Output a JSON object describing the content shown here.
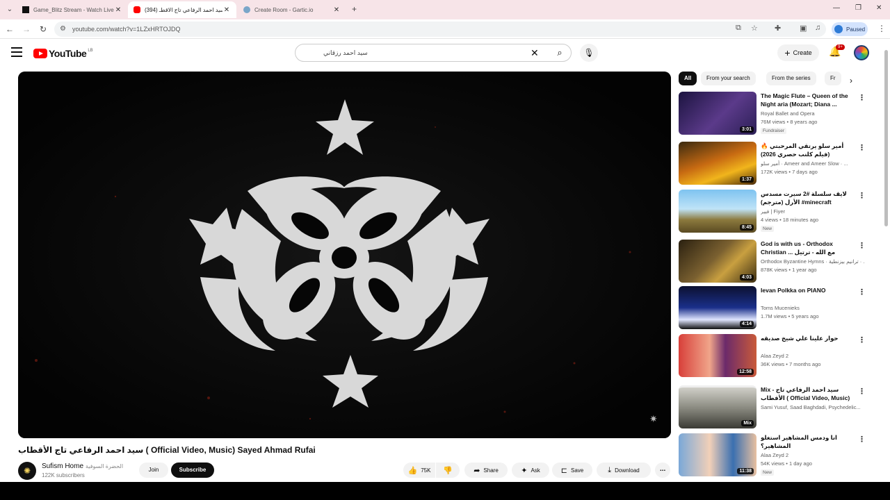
{
  "browser": {
    "tabs": [
      {
        "title": "Game_Blitz Stream - Watch Live",
        "active": false
      },
      {
        "title": "(394) سيد احمد الرفاعي تاج الاقطـ",
        "active": true
      },
      {
        "title": "Create Room - Gartic.io",
        "active": false
      }
    ],
    "url": "youtube.com/watch?v=1LZxHRTOJDQ",
    "profile_status": "Paused"
  },
  "youtube": {
    "logo_text": "YouTube",
    "country_code": "LB",
    "search_query": "سيد احمد رزقاني",
    "create_label": "Create",
    "notification_count": "9+"
  },
  "video": {
    "title": "سيد احمد الرفاعي تاج الأقطاب ( Official Video, Music) Sayed Ahmad Rufai",
    "channel_name": "Sufism Home",
    "channel_name_ar": "الحضرة السوفية",
    "subscribers": "122K subscribers",
    "join_label": "Join",
    "subscribe_label": "Subscribe",
    "likes": "75K",
    "share_label": "Share",
    "ask_label": "Ask",
    "save_label": "Save",
    "download_label": "Download"
  },
  "chips": [
    "All",
    "From your search",
    "From the series",
    "Fr"
  ],
  "recommendations": [
    {
      "title": "The Magic Flute – Queen of the Night aria (Mozart; Diana ...",
      "channel": "Royal Ballet and Opera",
      "meta": "76M views • 8 years ago",
      "tag": "Fundraiser",
      "duration": "3:01"
    },
    {
      "title": "أمير سلو يرتقي المرحبتي 🔥 (فيلم كلنب حصري 2026)",
      "channel": "أمير سلو · Ameer and Ameer Slow · ...",
      "meta": "172K views • 7 days ago",
      "tag": "",
      "duration": "1:37"
    },
    {
      "title": "لايف سلسلة #2 سيرت مسدس الأرل (مترجم) #minecraft",
      "channel": "فيير | Fiyer",
      "meta": "4 views • 18 minutes ago",
      "tag": "New",
      "duration": "8:45"
    },
    {
      "title": "God is with us - Orthodox Christian ... مع الله - ترتيل بيزنطية",
      "channel": "Orthodox Byzantine Hymns · ترانيم بيزنطية · ...",
      "meta": "878K views • 1 year ago",
      "tag": "",
      "duration": "4:03"
    },
    {
      "title": "Ievan Polkka on PIANO",
      "channel": "Toms Mucenieks",
      "meta": "1.7M views • 5 years ago",
      "tag": "",
      "duration": "4:14"
    },
    {
      "title": "حوار علينا علي شيخ صديقه",
      "channel": "Alaa Zeyd 2",
      "meta": "36K views • 7 months ago",
      "tag": "",
      "duration": "12:58"
    },
    {
      "title": "Mix - سيد احمد الرفاعي تاج الأقطاب ( Official Video, Music) Saye...",
      "channel": "Sami Yusuf, Saad Baghdadi, Psychedelic...",
      "meta": "",
      "tag": "",
      "duration": "Mix"
    },
    {
      "title": "انا ودمس المشاهير استغلو المشاهير؟",
      "channel": "Alaa Zeyd 2",
      "meta": "54K views • 1 day ago",
      "tag": "New",
      "duration": "11:38"
    }
  ],
  "colors": {
    "youtube_red": "#ff0000",
    "tab_strip": "#f7e4e8",
    "profile_paused": "#d3e3fd"
  },
  "icons": [
    "hamburger-icon",
    "search-icon",
    "mic-icon",
    "bell-icon",
    "like-icon",
    "dislike-icon",
    "share-icon",
    "sparkle-icon",
    "save-icon",
    "download-icon",
    "more-icon"
  ]
}
